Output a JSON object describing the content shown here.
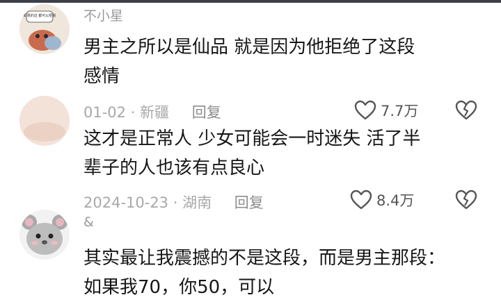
{
  "comments": [
    {
      "username": "不小星",
      "avatar_text": "耶惠的这 都可以把我",
      "text_line1": "男主之所以是仙品  就是因为他拒绝了这段",
      "text_line2": "感情",
      "date": "01-02",
      "location": "新疆",
      "reply_label": "回复",
      "likes": "7.7万"
    },
    {
      "text_line1": "这才是正常人 少女可能会一时迷失 活了半",
      "text_line2": "辈子的人也该有点良心",
      "date": "2024-10-23",
      "location": "湖南",
      "reply_label": "回复",
      "likes": "8.4万"
    },
    {
      "username": "&",
      "text_line1": "其实最让我震撼的不是这段，而是男主那段：",
      "text_line2": "如果我70，你50，可以"
    }
  ],
  "separator": " · ",
  "colors": {
    "text": "#161616",
    "meta": "#a8a8a8",
    "topbar": "#3a3f4a"
  },
  "icons": {
    "like": "heart-outline-icon",
    "dislike": "broken-heart-icon"
  }
}
